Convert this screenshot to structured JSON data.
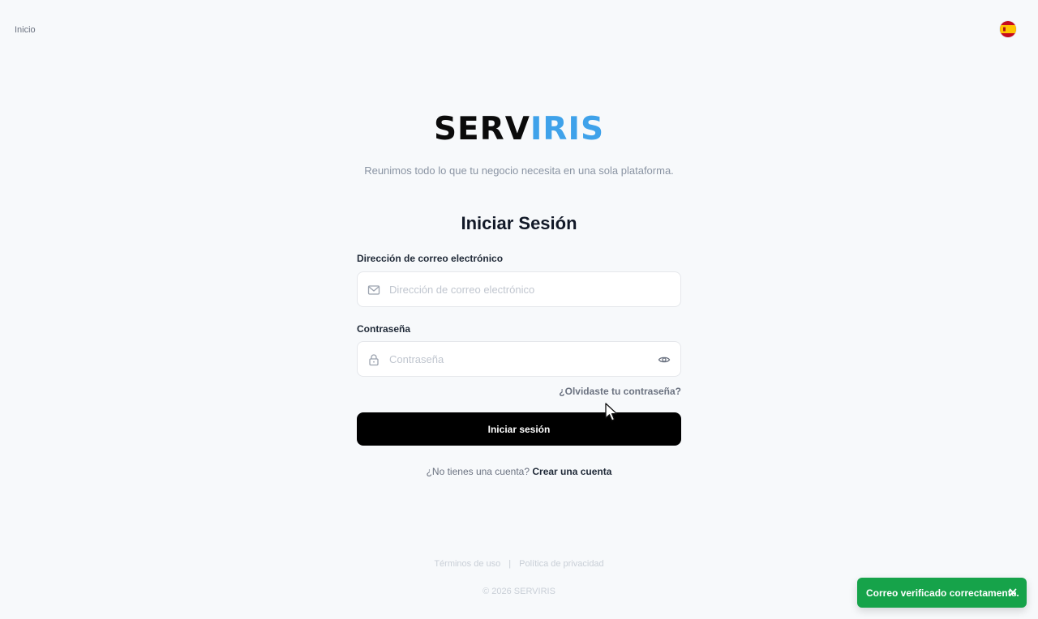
{
  "nav": {
    "home_label": "Inicio",
    "language_flag": "spain-flag-icon"
  },
  "brand": {
    "part_a": "SERV",
    "part_b": "IRIS",
    "color_a": "#0b0b0b",
    "color_b": "#3fa2ea",
    "tagline": "Reunimos todo lo que tu negocio necesita en una sola plataforma."
  },
  "login": {
    "title": "Iniciar Sesión",
    "email": {
      "label": "Dirección de correo electrónico",
      "placeholder": "Dirección de correo electrónico",
      "value": "",
      "icon": "mail-icon"
    },
    "password": {
      "label": "Contraseña",
      "placeholder": "Contraseña",
      "value": "",
      "icon": "lock-icon",
      "toggle_icon": "eye-icon"
    },
    "forgot_label": "¿Olvidaste tu contraseña?",
    "submit_label": "Iniciar sesión",
    "signup_prompt": "¿No tienes una cuenta?",
    "signup_link": "Crear una cuenta"
  },
  "footer": {
    "terms_label": "Términos de uso",
    "separator": "|",
    "privacy_label": "Política de privacidad",
    "copyright": "© 2026 SERVIRIS"
  },
  "toast": {
    "message": "Correo verificado correctamente.",
    "color": "#16a34a",
    "close_icon": "close-icon"
  }
}
